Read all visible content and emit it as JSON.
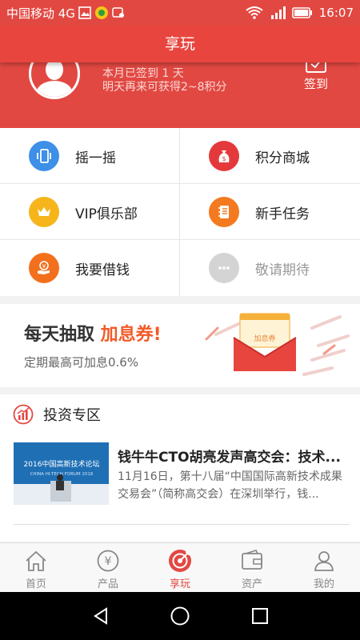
{
  "status": {
    "carrier": "中国移动 4G",
    "time": "16:07"
  },
  "title": "享玩",
  "signin": {
    "line1": "本月已签到 1 天",
    "line2": "明天再来可获得2~8积分",
    "button": "签到"
  },
  "menu": [
    {
      "label": "摇一摇",
      "icon": "phone-shake-icon",
      "color": "#3d8fe8"
    },
    {
      "label": "积分商城",
      "icon": "money-bag-icon",
      "color": "#e4393c"
    },
    {
      "label": "VIP俱乐部",
      "icon": "crown-icon",
      "color": "#f5b51b"
    },
    {
      "label": "新手任务",
      "icon": "notebook-icon",
      "color": "#f47a1f"
    },
    {
      "label": "我要借钱",
      "icon": "hand-yuan-icon",
      "color": "#f2701d"
    },
    {
      "label": "敬请期待",
      "icon": "more-dots-icon",
      "color": "#cfcfcf"
    }
  ],
  "promo": {
    "title_a": "每天抽取 ",
    "title_b": "加息券!",
    "subtitle": "定期最高可加息0.6%",
    "coupon_label": "加息券"
  },
  "invest": {
    "title": "投资专区",
    "news_title": "钱牛牛CTO胡亮发声高交会：技术...",
    "news_desc": "11月16日，第十八届“中国国际高新技术成果交易会”（简称高交会）在深圳举行，钱...",
    "image_text": "2016中国高新技术论坛",
    "image_subtext": "CHINA HI-TECH FORUM 2016"
  },
  "tabs": [
    {
      "label": "首页",
      "icon": "home-icon"
    },
    {
      "label": "产品",
      "icon": "yuan-circle-icon"
    },
    {
      "label": "享玩",
      "icon": "target-icon"
    },
    {
      "label": "资产",
      "icon": "wallet-icon"
    },
    {
      "label": "我的",
      "icon": "user-icon"
    }
  ],
  "colors": {
    "brand": "#e24842",
    "accent": "#f25a28"
  }
}
